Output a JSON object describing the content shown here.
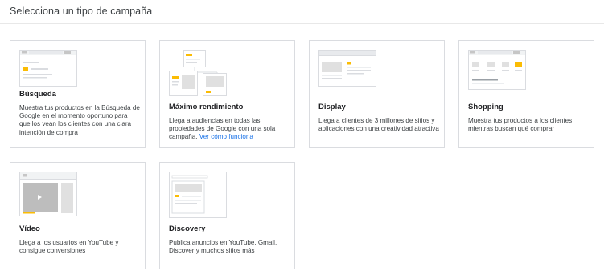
{
  "header": {
    "title": "Selecciona un tipo de campaña"
  },
  "cards": [
    {
      "title": "Búsqueda",
      "description": "Muestra tus productos en la Búsqueda de Google en el momento oportuno para que los vean los clientes con una clara intención de compra",
      "icon": "search-ad-illustration"
    },
    {
      "title": "Máximo rendimiento",
      "description": "Llega a audiencias en todas las propiedades de Google con una sola campaña.",
      "link": "Ver cómo funciona",
      "icon": "performance-max-illustration"
    },
    {
      "title": "Display",
      "description": "Llega a clientes de 3 millones de sitios y aplicaciones con una creatividad atractiva",
      "icon": "display-ad-illustration"
    },
    {
      "title": "Shopping",
      "description": "Muestra tus productos a los clientes mientras buscan qué comprar",
      "icon": "shopping-ad-illustration"
    },
    {
      "title": "Vídeo",
      "description": "Llega a los usuarios en YouTube y consigue conversiones",
      "icon": "video-ad-illustration"
    },
    {
      "title": "Discovery",
      "description": "Publica anuncios en YouTube, Gmail, Discover y muchos sitios más",
      "icon": "discovery-ad-illustration"
    }
  ],
  "colors": {
    "accent_yellow": "#fbbc04",
    "link_blue": "#1a73e8",
    "card_border": "#dadce0",
    "placeholder_gray": "#e0e0e0"
  }
}
